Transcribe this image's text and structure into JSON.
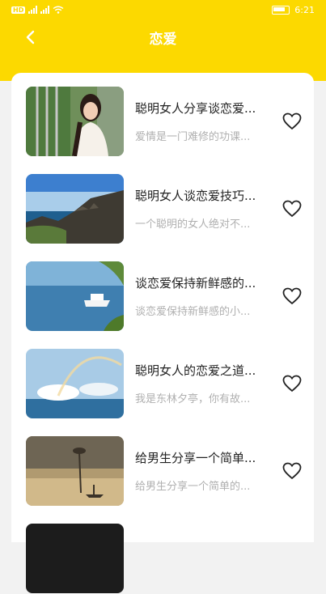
{
  "status": {
    "network_label": "HD",
    "time": "6:21"
  },
  "header": {
    "title": "恋爱"
  },
  "colors": {
    "accent": "#fcd900"
  },
  "items": [
    {
      "title": "聪明女人分享谈恋爱...",
      "subtitle": "爱情是一门难修的功课...",
      "favorited": false,
      "thumb": "woman-portrait"
    },
    {
      "title": "聪明女人谈恋爱技巧...",
      "subtitle": "一个聪明的女人绝对不...",
      "favorited": false,
      "thumb": "coastline-rocks"
    },
    {
      "title": "谈恋爱保持新鲜感的...",
      "subtitle": "谈恋爱保持新鲜感的小...",
      "favorited": false,
      "thumb": "cruise-ship"
    },
    {
      "title": "聪明女人的恋爱之道...",
      "subtitle": "我是东林夕亭，你有故...",
      "favorited": false,
      "thumb": "rainbow-sea"
    },
    {
      "title": "给男生分享一个简单...",
      "subtitle": "给男生分享一个简单的...",
      "favorited": false,
      "thumb": "misty-lake"
    }
  ]
}
